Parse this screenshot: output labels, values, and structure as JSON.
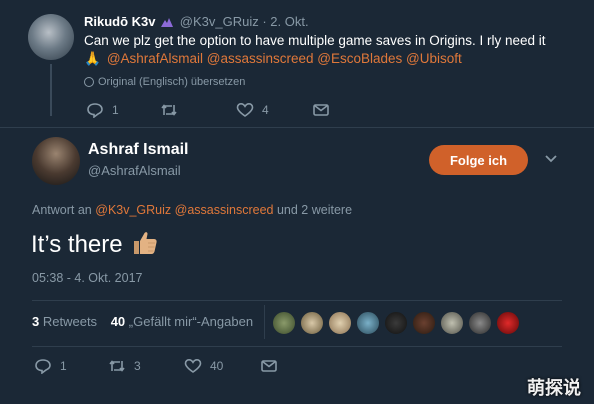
{
  "colors": {
    "background": "#1b2836",
    "accent": "#d0612a",
    "link": "#e0783a",
    "muted": "#8899a6"
  },
  "reply_tweet": {
    "author_name": "Rikudō K3v",
    "handle": "@K3v_GRuiz",
    "date": "· 2. Okt.",
    "text": "Can we plz get the option to have multiple game saves in Origins. I rly need it",
    "emoji": "🙏",
    "mentions": "@AshrafAlsmail @assassinscreed @EscoBlades @Ubisoft",
    "translate_label": "Original (Englisch) übersetzen",
    "replies": "1",
    "retweets": "",
    "likes": "4"
  },
  "main_tweet": {
    "author_name": "Ashraf Ismail",
    "handle": "@AshrafAlsmail",
    "follow_label": "Folge ich",
    "reply_to_prefix": "Antwort an",
    "reply_to_mentions": "@K3v_GRuiz @assassinscreed",
    "reply_to_suffix": "und 2 weitere",
    "text": "It’s there",
    "timestamp": "05:38 - 4. Okt. 2017",
    "retweets_count": "3",
    "retweets_label": "Retweets",
    "likes_count": "40",
    "likes_label": "„Gefällt mir“-Angaben",
    "action_replies": "1",
    "action_retweets": "3",
    "action_likes": "40"
  },
  "icons": [
    "reply-icon",
    "retweet-icon",
    "like-icon",
    "dm-icon",
    "chevron-down-icon",
    "globe-icon",
    "thumbs-up-emoji",
    "pray-emoji"
  ],
  "watermark": "萌探说"
}
